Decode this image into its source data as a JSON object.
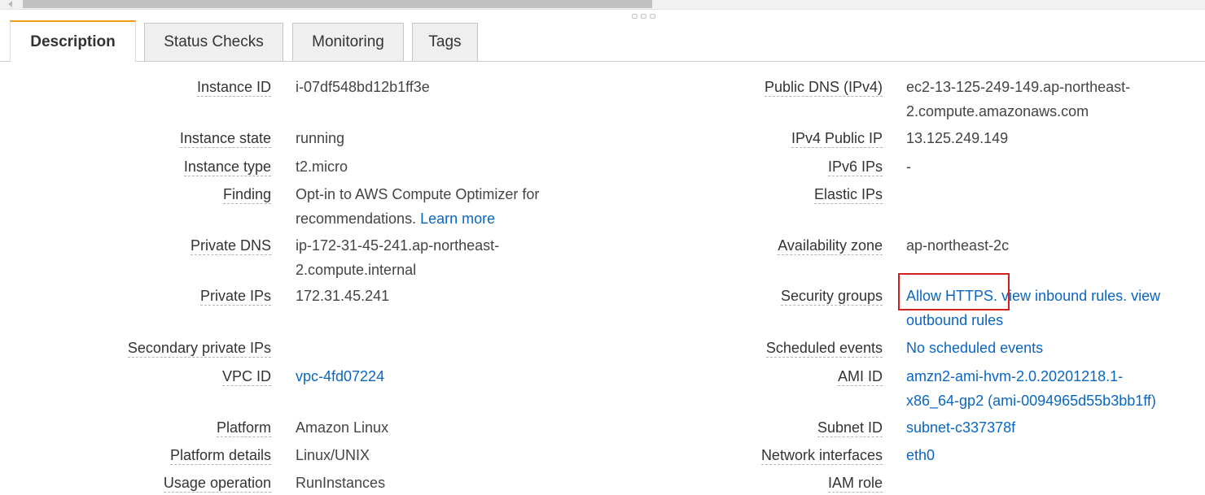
{
  "tabs": [
    {
      "label": "Description",
      "active": true
    },
    {
      "label": "Status Checks",
      "active": false
    },
    {
      "label": "Monitoring",
      "active": false
    },
    {
      "label": "Tags",
      "active": false
    }
  ],
  "left": {
    "instance_id": {
      "label": "Instance ID",
      "value": "i-07df548bd12b1ff3e"
    },
    "instance_state": {
      "label": "Instance state",
      "value": "running"
    },
    "instance_type": {
      "label": "Instance type",
      "value": "t2.micro"
    },
    "finding": {
      "label": "Finding",
      "text": "Opt-in to AWS Compute Optimizer for recommendations.",
      "link": "Learn more"
    },
    "private_dns": {
      "label": "Private DNS",
      "line1": "ip-172-31-45-241.ap-northeast-",
      "line2": "2.compute.internal"
    },
    "private_ips": {
      "label": "Private IPs",
      "value": "172.31.45.241"
    },
    "secondary_private_ips": {
      "label": "Secondary private IPs",
      "value": ""
    },
    "vpc_id": {
      "label": "VPC ID",
      "value": "vpc-4fd07224"
    },
    "platform": {
      "label": "Platform",
      "value": "Amazon Linux"
    },
    "platform_details": {
      "label": "Platform details",
      "value": "Linux/UNIX"
    },
    "usage_operation": {
      "label": "Usage operation",
      "value": "RunInstances"
    }
  },
  "right": {
    "public_dns": {
      "label": "Public DNS (IPv4)",
      "line1": "ec2-13-125-249-149.ap-northeast-",
      "line2": "2.compute.amazonaws.com"
    },
    "ipv4_public_ip": {
      "label": "IPv4 Public IP",
      "value": "13.125.249.149"
    },
    "ipv6_ips": {
      "label": "IPv6 IPs",
      "value": "-"
    },
    "elastic_ips": {
      "label": "Elastic IPs",
      "value": ""
    },
    "availability_zone": {
      "label": "Availability zone",
      "value": "ap-northeast-2c"
    },
    "security_groups": {
      "label": "Security groups",
      "group": "Allow HTTPS.",
      "inbound": "view inbound rules.",
      "outbound_line1": "view",
      "outbound_line2": "outbound rules"
    },
    "scheduled_events": {
      "label": "Scheduled events",
      "value": "No scheduled events"
    },
    "ami_id": {
      "label": "AMI ID",
      "line1": "amzn2-ami-hvm-2.0.20201218.1-",
      "line2": "x86_64-gp2 (ami-0094965d55b3bb1ff)"
    },
    "subnet_id": {
      "label": "Subnet ID",
      "value": "subnet-c337378f"
    },
    "network_interfaces": {
      "label": "Network interfaces",
      "value": "eth0"
    },
    "iam_role": {
      "label": "IAM role",
      "value": ""
    }
  },
  "colors": {
    "link": "#0b66c2",
    "active_tab_accent": "#f09d1c",
    "highlight": "#d21f1f"
  },
  "icons": [
    "resize-grip-icon",
    "scroll-left-arrow-icon"
  ]
}
